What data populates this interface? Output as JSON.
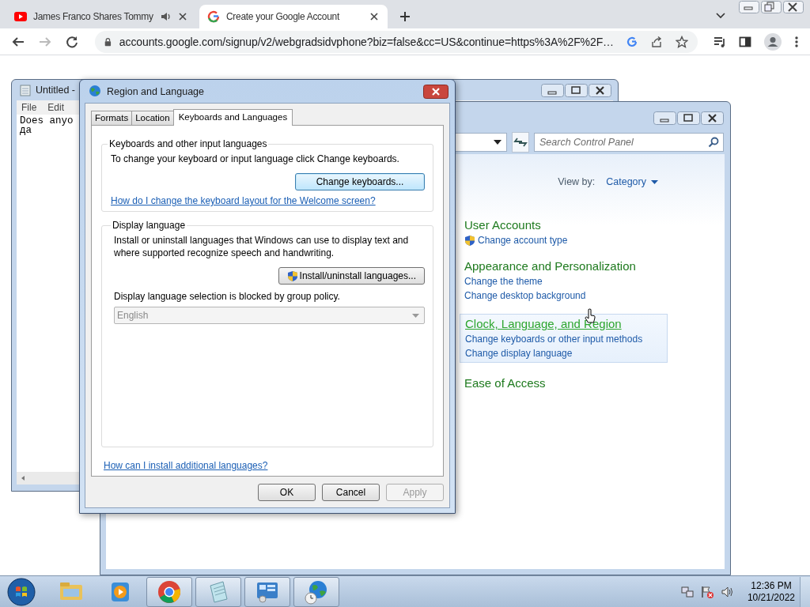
{
  "browser": {
    "tabs": [
      {
        "title": "James Franco Shares Tommy",
        "selected": false,
        "kind": "video",
        "audio": true
      },
      {
        "title": "Create your Google Account",
        "selected": true,
        "kind": "google",
        "audio": false
      }
    ],
    "nav": [
      {
        "kind": "back",
        "disabled": false
      },
      {
        "kind": "forward",
        "disabled": true
      },
      {
        "kind": "reload",
        "disabled": false
      }
    ],
    "url": "accounts.google.com/signup/v2/webgradsidvphone?biz=false&cc=US&continue=https%3A%2F%2F…"
  },
  "notepad": {
    "title": "Untitled -",
    "menu": [
      "File",
      "Edit"
    ],
    "lines": [
      "Does anyo",
      "да"
    ]
  },
  "control_panel": {
    "search_placeholder": "Search Control Panel",
    "view_by_label": "View by:",
    "view_by_value": "Category",
    "categories": [
      {
        "title": "User Accounts",
        "highlighted": false,
        "links": [
          {
            "text": "Change account type",
            "shield": true
          }
        ]
      },
      {
        "title": "Appearance and Personalization",
        "highlighted": false,
        "links": [
          {
            "text": "Change the theme",
            "shield": false
          },
          {
            "text": "Change desktop background",
            "shield": false
          }
        ]
      },
      {
        "title": "Clock, Language, and Region",
        "highlighted": true,
        "links": [
          {
            "text": "Change keyboards or other input methods",
            "shield": false
          },
          {
            "text": "Change display language",
            "shield": false
          }
        ]
      },
      {
        "title": "Ease of Access",
        "highlighted": false
      }
    ]
  },
  "dialog": {
    "title": "Region and Language",
    "tabs": [
      {
        "label": "Formats",
        "selected": false
      },
      {
        "label": "Location",
        "selected": false
      },
      {
        "label": "Keyboards and Languages",
        "selected": true
      }
    ],
    "keyboards": {
      "legend": "Keyboards and other input languages",
      "text": "To change your keyboard or input language click Change keyboards.",
      "button": "Change keyboards...",
      "link": "How do I change the keyboard layout for the Welcome screen?"
    },
    "display": {
      "legend": "Display language",
      "text": "Install or uninstall languages that Windows can use to display text and where supported recognize speech and handwriting.",
      "button": "Install/uninstall languages...",
      "note": "Display language selection is blocked by group policy.",
      "dropdown": {
        "value": "English",
        "disabled": true
      }
    },
    "footer_link": "How can I install additional languages?",
    "buttons": [
      {
        "label": "OK",
        "disabled": false
      },
      {
        "label": "Cancel",
        "disabled": false
      },
      {
        "label": "Apply",
        "disabled": true
      }
    ]
  },
  "taskbar": {
    "items": [
      {
        "kind": "explorer",
        "running": false
      },
      {
        "kind": "media",
        "running": false
      },
      {
        "kind": "chrome",
        "running": true
      },
      {
        "kind": "notepad",
        "running": true
      },
      {
        "kind": "control",
        "running": true
      },
      {
        "kind": "region",
        "running": true
      }
    ],
    "time": "12:36 PM",
    "date": "10/21/2022"
  }
}
